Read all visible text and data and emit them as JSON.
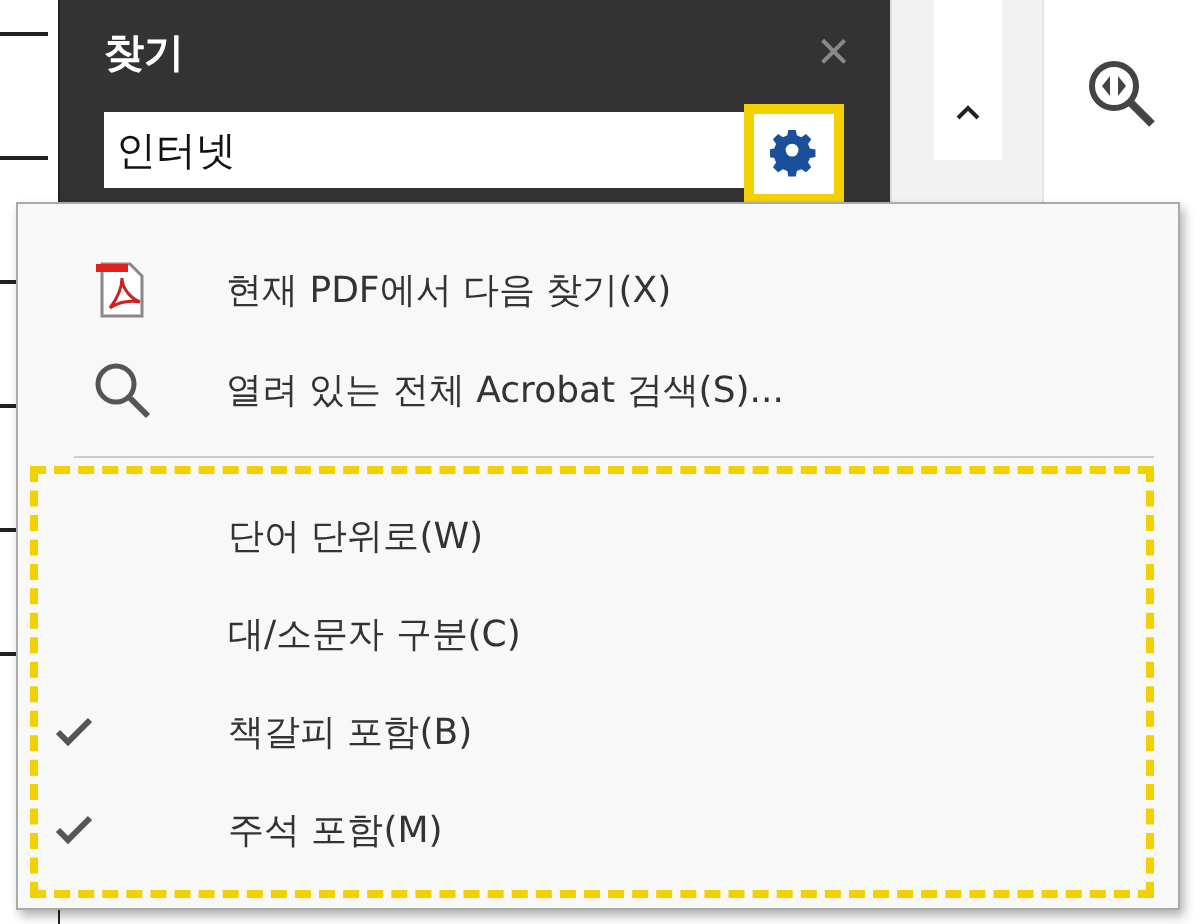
{
  "find_panel": {
    "title": "찾기",
    "close": "×",
    "query": "인터넷"
  },
  "menu": {
    "actions": [
      {
        "kind": "pdf",
        "label": "현재 PDF에서 다음 찾기(X)"
      },
      {
        "kind": "search",
        "label": "열려 있는 전체 Acrobat 검색(S)..."
      }
    ],
    "options": [
      {
        "label": "단어 단위로(W)",
        "checked": false
      },
      {
        "label": "대/소문자 구분(C)",
        "checked": false
      },
      {
        "label": "책갈피 포함(B)",
        "checked": true
      },
      {
        "label": "주석 포함(M)",
        "checked": true
      }
    ]
  }
}
